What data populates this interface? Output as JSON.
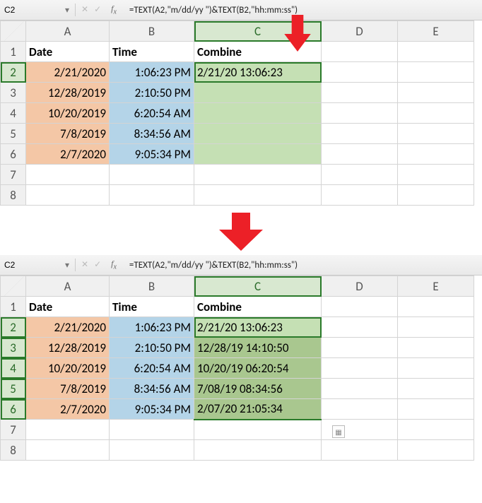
{
  "formula_bar": {
    "cell_ref": "C2",
    "formula": "=TEXT(A2,\"m/dd/yy \")&TEXT(B2,\"hh:mm:ss\")"
  },
  "columns": [
    "A",
    "B",
    "C",
    "D",
    "E"
  ],
  "rows": [
    "1",
    "2",
    "3",
    "4",
    "5",
    "6",
    "7",
    "8"
  ],
  "headers": {
    "a": "Date",
    "b": "Time",
    "c": "Combine"
  },
  "data": {
    "dates": [
      "2/21/2020",
      "12/28/2019",
      "10/20/2019",
      "7/8/2019",
      "2/7/2020"
    ],
    "times": [
      "1:06:23 PM",
      "2:10:50 PM",
      "6:20:54 AM",
      "8:34:56 AM",
      "9:05:34 PM"
    ],
    "combine_before": [
      "2/21/20 13:06:23",
      "",
      "",
      "",
      ""
    ],
    "combine_after": [
      "2/21/20 13:06:23",
      "12/28/19 14:10:50",
      "10/20/19 06:20:54",
      "7/08/19 08:34:56",
      "2/07/20 21:05:34"
    ]
  },
  "icons": {
    "cancel": "✕",
    "enter": "✓"
  }
}
